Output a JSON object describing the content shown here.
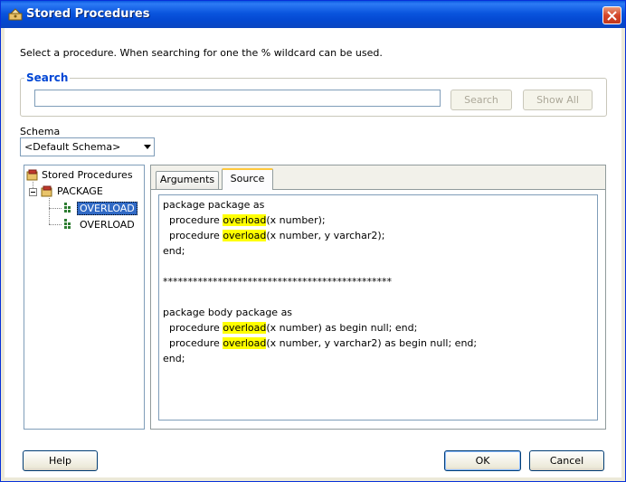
{
  "window": {
    "title": "Stored Procedures"
  },
  "instruction": "Select a procedure. When searching for one the % wildcard can be used.",
  "search": {
    "legend": "Search",
    "value": "",
    "search_button": "Search",
    "show_all_button": "Show All"
  },
  "schema": {
    "label": "Schema",
    "selected": "<Default Schema>"
  },
  "tree": {
    "root": "Stored Procedures",
    "package": "PACKAGE",
    "items": [
      "OVERLOAD",
      "OVERLOAD"
    ]
  },
  "tabs": [
    "Arguments",
    "Source"
  ],
  "source": {
    "lines": [
      [
        {
          "t": "package package as"
        }
      ],
      [
        {
          "t": "  procedure "
        },
        {
          "t": "overload",
          "hl": true
        },
        {
          "t": "(x number);"
        }
      ],
      [
        {
          "t": "  procedure "
        },
        {
          "t": "overload",
          "hl": true
        },
        {
          "t": "(x number, y varchar2);"
        }
      ],
      [
        {
          "t": "end;"
        }
      ],
      [
        {
          "t": ""
        }
      ],
      [
        {
          "t": "**********************************************"
        }
      ],
      [
        {
          "t": ""
        }
      ],
      [
        {
          "t": "package body package as"
        }
      ],
      [
        {
          "t": "  procedure "
        },
        {
          "t": "overload",
          "hl": true
        },
        {
          "t": "(x number) as begin null; end;"
        }
      ],
      [
        {
          "t": "  procedure "
        },
        {
          "t": "overload",
          "hl": true
        },
        {
          "t": "(x number, y varchar2) as begin null; end;"
        }
      ],
      [
        {
          "t": "end;"
        }
      ]
    ]
  },
  "buttons": {
    "help": "Help",
    "ok": "OK",
    "cancel": "Cancel"
  },
  "colors": {
    "titlebar": "#0a55de",
    "selection": "#316ac5",
    "highlight": "#ffff00",
    "group_legend": "#0046d5"
  }
}
